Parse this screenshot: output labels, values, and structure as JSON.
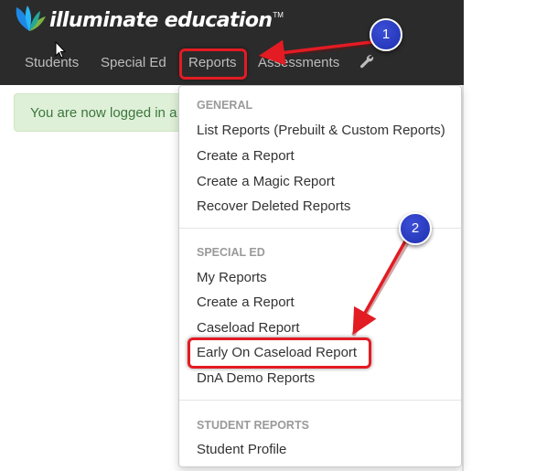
{
  "logo": {
    "text": "illuminate education",
    "tm": "TM"
  },
  "nav": {
    "students": "Students",
    "special_ed": "Special Ed",
    "reports": "Reports",
    "assessments": "Assessments"
  },
  "alert": {
    "text": "You are now logged in a"
  },
  "dropdown": {
    "general_header": "GENERAL",
    "general_items": [
      "List Reports (Prebuilt & Custom Reports)",
      "Create a Report",
      "Create a Magic Report",
      "Recover Deleted Reports"
    ],
    "special_ed_header": "SPECIAL ED",
    "special_ed_items": [
      "My Reports",
      "Create a Report",
      "Caseload Report",
      "Early On Caseload Report",
      "DnA Demo Reports"
    ],
    "student_reports_header": "STUDENT REPORTS",
    "student_reports_items": [
      "Student Profile"
    ]
  },
  "callouts": {
    "first": "1",
    "second": "2"
  },
  "colors": {
    "topbar": "#2b2b2b",
    "nav_text": "#bdbdbd",
    "alert_bg": "#dff0d8",
    "alert_text": "#3c763d",
    "highlight_red": "#e31b23",
    "callout_blue": "#2438c4"
  }
}
